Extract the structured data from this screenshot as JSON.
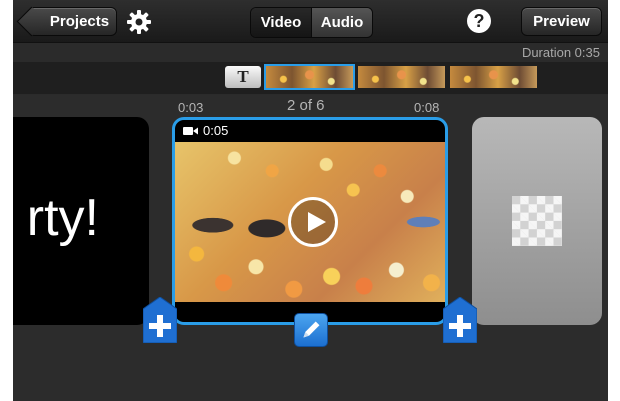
{
  "toolbar": {
    "back_label": "Projects",
    "settings_icon": "gear-icon",
    "segments": [
      "Video",
      "Audio"
    ],
    "selected_segment": "Audio",
    "help_label": "?",
    "preview_label": "Preview"
  },
  "duration": {
    "label": "Duration 0:35"
  },
  "title_tool": {
    "label": "T"
  },
  "timeline": {
    "start_time": "0:03",
    "position": "2 of 6",
    "end_time": "0:08",
    "prev_clip_text": "rty!",
    "clip": {
      "duration": "0:05",
      "icon": "video-camera-icon"
    },
    "next_clip_icon": "checkerboard-transition-icon"
  },
  "colors": {
    "accent": "#2a9de8",
    "button_blue": "#1c6fd0"
  }
}
